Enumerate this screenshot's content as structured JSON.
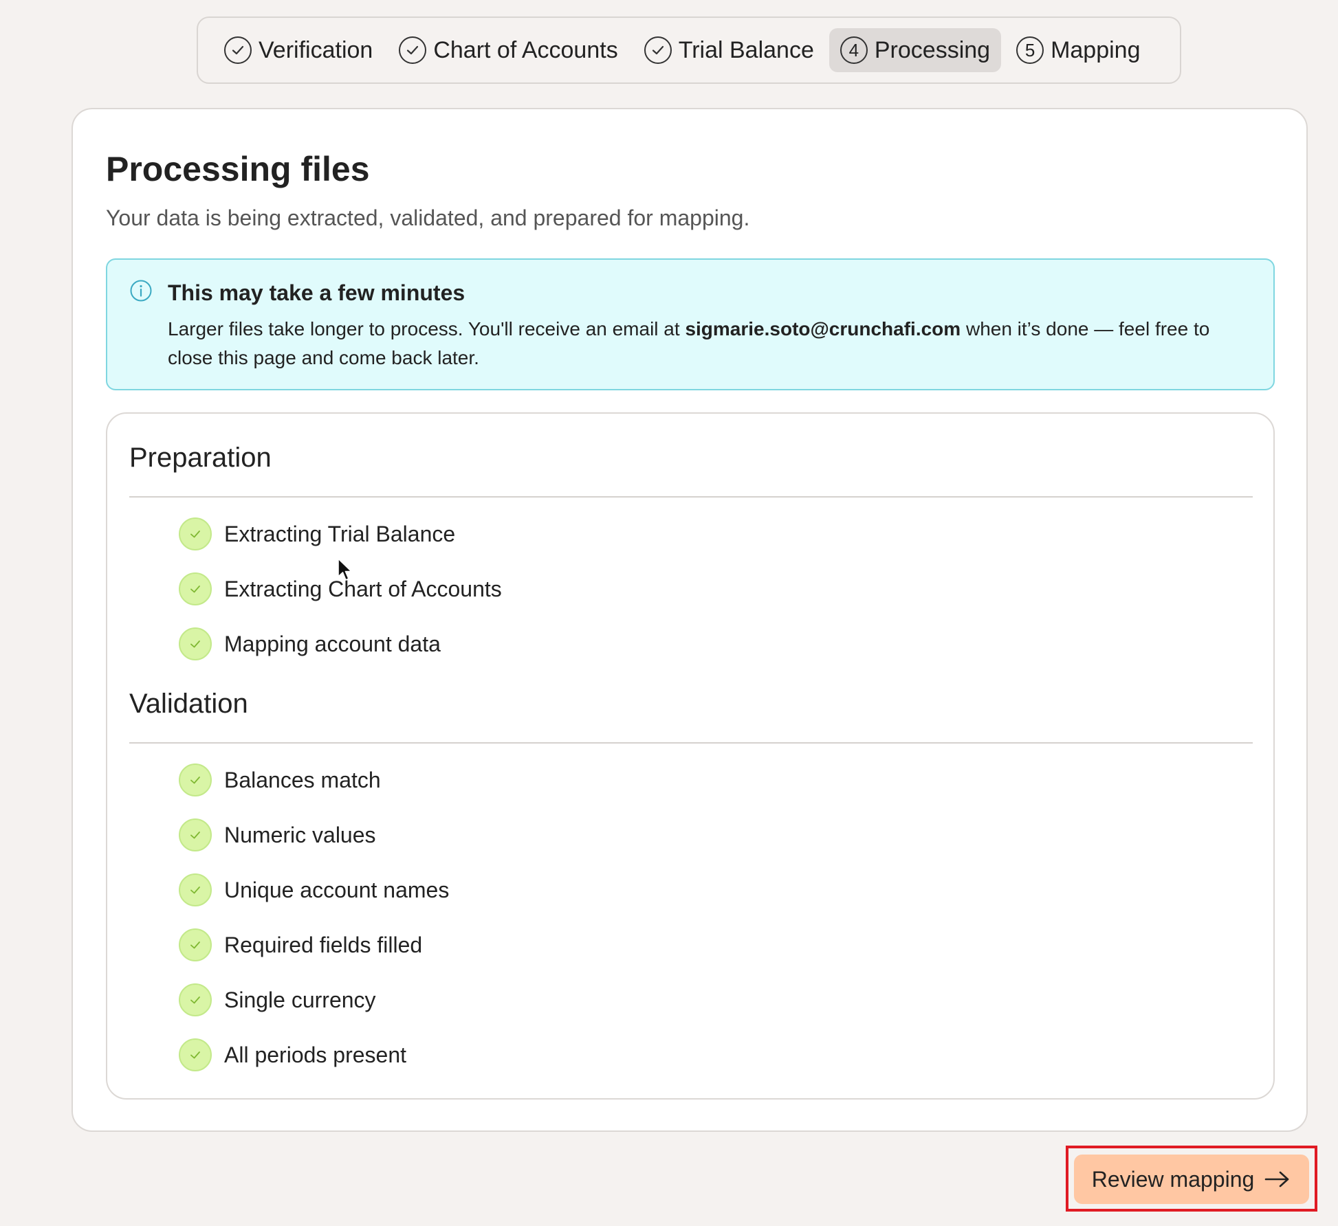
{
  "stepper": {
    "steps": [
      {
        "label": "Verification",
        "state": "complete",
        "icon": "check-circle-icon"
      },
      {
        "label": "Chart of Accounts",
        "state": "complete",
        "icon": "check-circle-icon"
      },
      {
        "label": "Trial Balance",
        "state": "complete",
        "icon": "check-circle-icon"
      },
      {
        "label": "Processing",
        "state": "active",
        "number": "4"
      },
      {
        "label": "Mapping",
        "state": "upcoming",
        "number": "5"
      }
    ]
  },
  "page": {
    "title": "Processing files",
    "subtitle": "Your data is being extracted, validated, and prepared for mapping."
  },
  "notice": {
    "icon": "info-icon",
    "title": "This may take a few minutes",
    "body_before": "Larger files take longer to process. You'll receive an email at ",
    "email": "sigmarie.soto@crunchafi.com",
    "body_after": " when it’s done — feel free to close this page and come back later."
  },
  "preparation": {
    "title": "Preparation",
    "items": [
      {
        "label": "Extracting Trial Balance",
        "status": "done"
      },
      {
        "label": "Extracting Chart of Accounts",
        "status": "done"
      },
      {
        "label": "Mapping account data",
        "status": "done"
      }
    ]
  },
  "validation": {
    "title": "Validation",
    "items": [
      {
        "label": "Balances match",
        "status": "done"
      },
      {
        "label": "Numeric values",
        "status": "done"
      },
      {
        "label": "Unique account names",
        "status": "done"
      },
      {
        "label": "Required fields filled",
        "status": "done"
      },
      {
        "label": "Single currency",
        "status": "done"
      },
      {
        "label": "All periods present",
        "status": "done"
      }
    ]
  },
  "actions": {
    "review_label": "Review mapping",
    "review_icon": "arrow-right-icon"
  },
  "colors": {
    "background": "#f5f2f0",
    "card": "#ffffff",
    "notice_bg": "#e0fbfc",
    "notice_border": "#7fd6e0",
    "check_bg": "#d9f5a6",
    "button_bg": "#ffc7a3",
    "highlight": "#e01b24"
  }
}
